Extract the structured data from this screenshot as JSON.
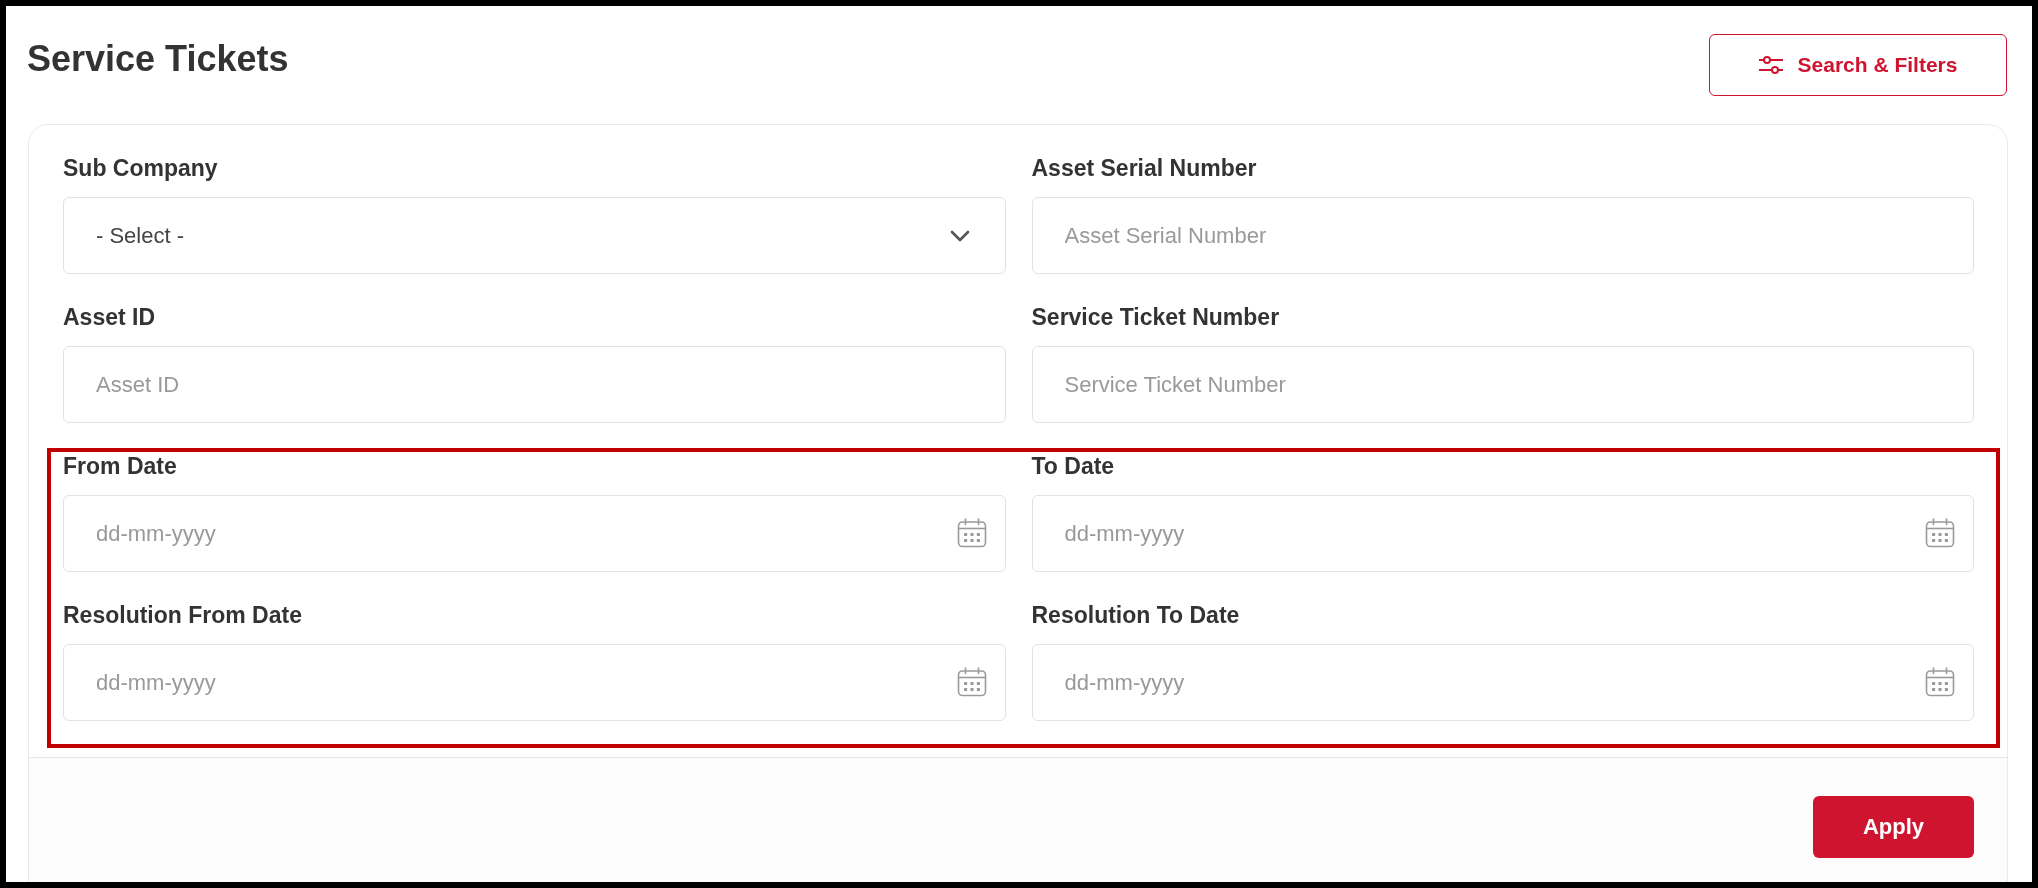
{
  "page": {
    "title": "Service Tickets"
  },
  "toolbar": {
    "search_filters_button": "Search & Filters"
  },
  "filters": {
    "groups": [
      {
        "highlighted": false,
        "fields": [
          {
            "kind": "select",
            "label": "Sub Company",
            "value": "- Select -"
          },
          {
            "kind": "text",
            "label": "Asset Serial Number",
            "placeholder": "Asset Serial Number"
          },
          {
            "kind": "text",
            "label": "Asset ID",
            "placeholder": "Asset ID"
          },
          {
            "kind": "text",
            "label": "Service Ticket Number",
            "placeholder": "Service Ticket Number"
          }
        ]
      },
      {
        "highlighted": true,
        "fields": [
          {
            "kind": "date",
            "label": "From Date",
            "placeholder": "dd-mm-yyyy"
          },
          {
            "kind": "date",
            "label": "To Date",
            "placeholder": "dd-mm-yyyy"
          },
          {
            "kind": "date",
            "label": "Resolution From Date",
            "placeholder": "dd-mm-yyyy"
          },
          {
            "kind": "date",
            "label": "Resolution To Date",
            "placeholder": "dd-mm-yyyy"
          }
        ]
      }
    ],
    "apply_button": "Apply"
  }
}
